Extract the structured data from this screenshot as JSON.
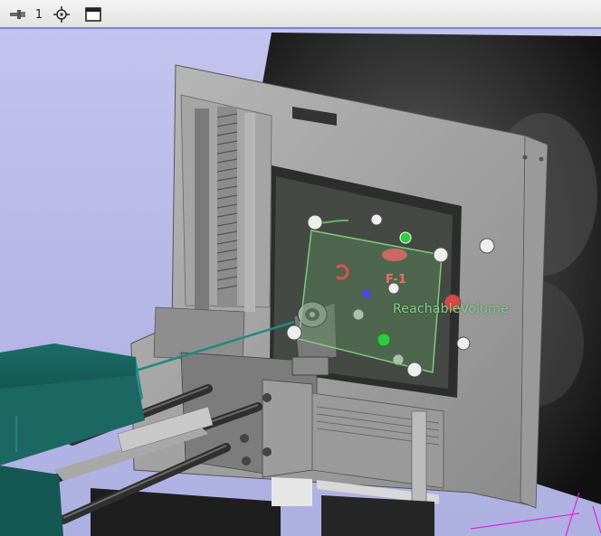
{
  "toolbar": {
    "pin_icon": "pin-icon",
    "view_link_number": "1",
    "crosshair_icon": "crosshair-icon",
    "maximize_icon": "maximize-view-icon"
  },
  "scene": {
    "background_color": "#b9b9e8",
    "reachable_volume_label": "ReachableVolume",
    "fiducial_label": "F-1"
  }
}
